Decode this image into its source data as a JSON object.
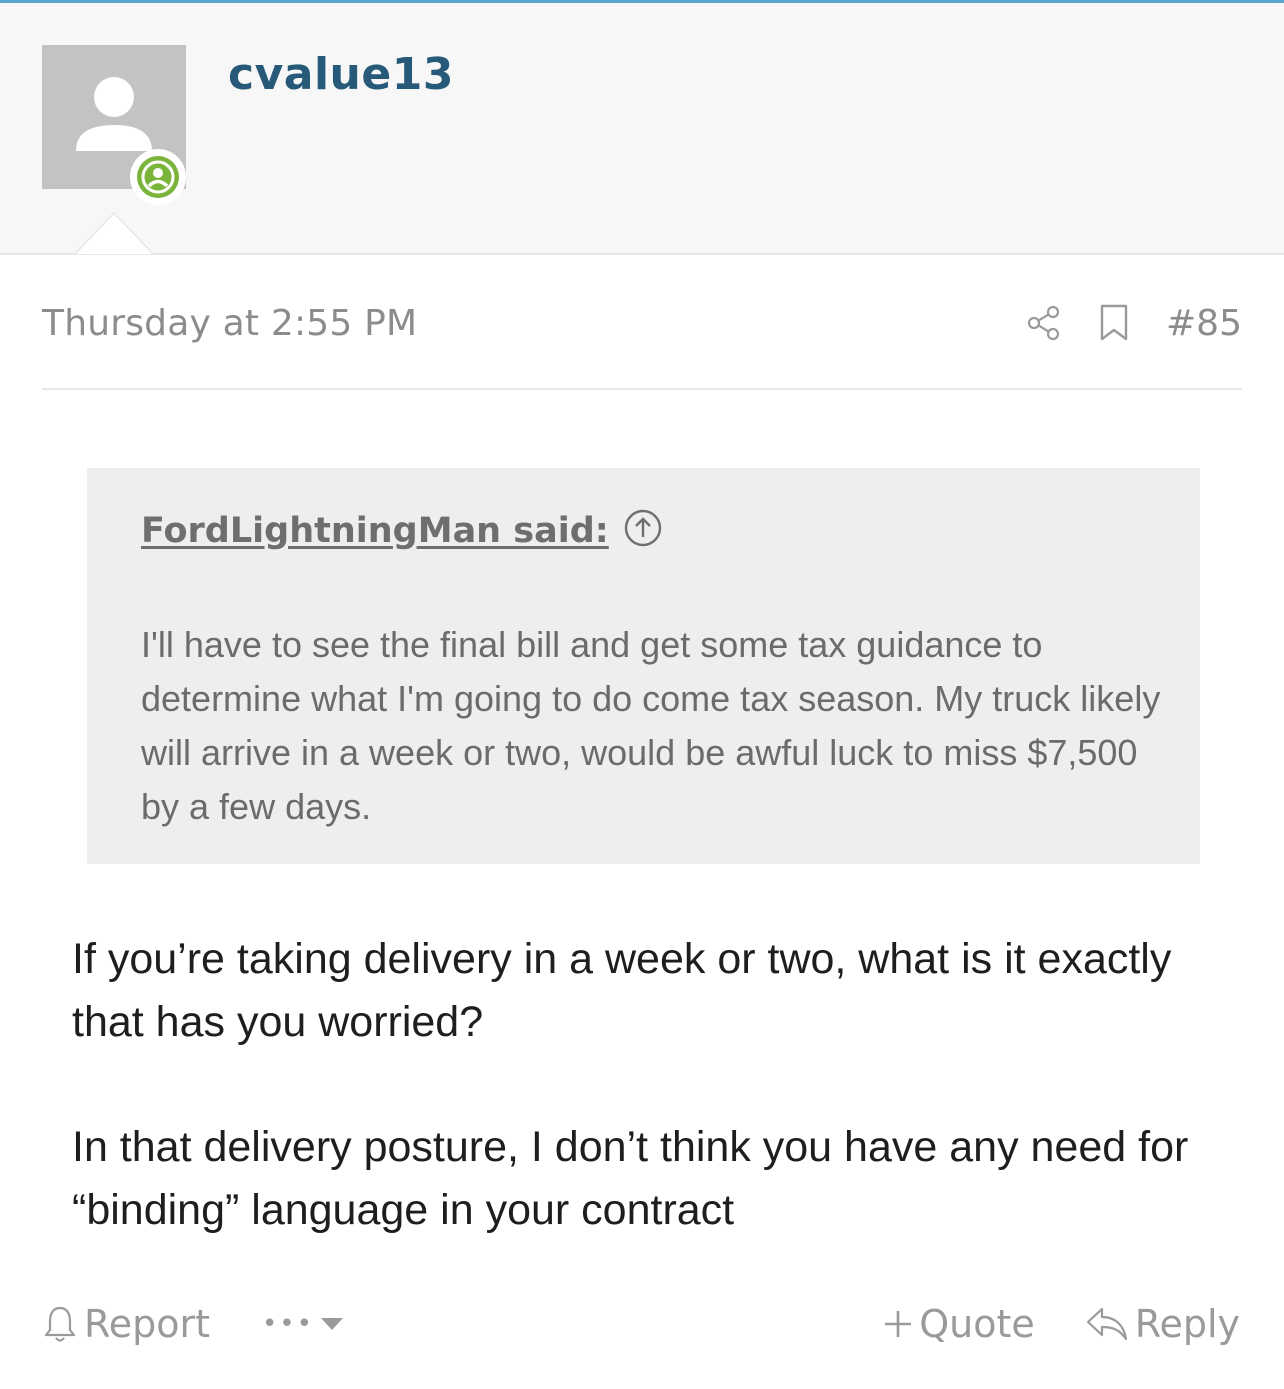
{
  "post": {
    "username": "cvalue13",
    "timestamp": "Thursday at 2:55 PM",
    "number": "#85",
    "quote": {
      "author_label": "FordLightningMan said:",
      "text": "I'll have to see the final bill and get some tax guidance to determine what I'm going to do come tax season. My truck likely will arrive in a week or two, would be awful luck to miss $7,500 by a few days."
    },
    "body": [
      "If you’re taking delivery in a week or two, what is it exactly that has you worried?",
      "In that delivery posture, I don’t think you have any need for “binding” language in your contract"
    ]
  },
  "actions": {
    "report": "Report",
    "more": "•••",
    "quote": "Quote",
    "reply": "Reply"
  },
  "icons": {
    "avatar": "default-user-icon",
    "status": "online-user-icon",
    "share": "share-icon",
    "bookmark": "bookmark-icon",
    "expand_quote": "arrow-up-circle-icon",
    "report": "bell-icon",
    "more": "caret-down-icon",
    "quote": "plus-icon",
    "reply": "reply-icon"
  },
  "colors": {
    "accent": "#5aa6cf",
    "username": "#265a78",
    "online": "#7bb43a"
  }
}
